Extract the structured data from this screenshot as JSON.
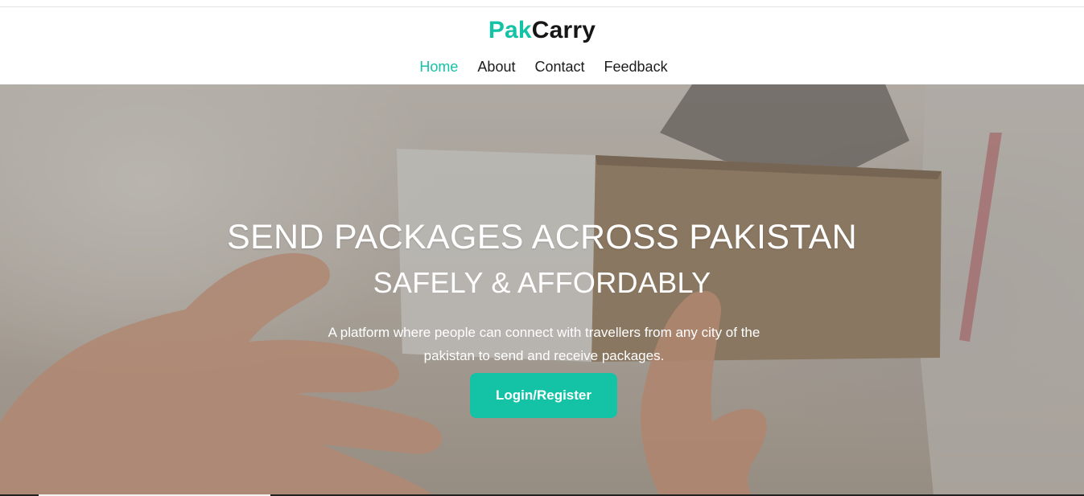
{
  "header": {
    "brand": {
      "part1": "Pak",
      "part2": "Carry"
    },
    "nav": [
      {
        "label": "Home",
        "active": true
      },
      {
        "label": "About",
        "active": false
      },
      {
        "label": "Contact",
        "active": false
      },
      {
        "label": "Feedback",
        "active": false
      }
    ]
  },
  "hero": {
    "title": "SEND PACKAGES ACROSS PAKISTAN",
    "subtitle": "SAFELY & AFFORDABLY",
    "description": "A platform where people can connect with travellers from any city of the pakistan to send and receive packages.",
    "cta_label": "Login/Register"
  },
  "colors": {
    "accent": "#14c2a6",
    "brand_dark": "#161616",
    "text_light": "#ffffff"
  }
}
